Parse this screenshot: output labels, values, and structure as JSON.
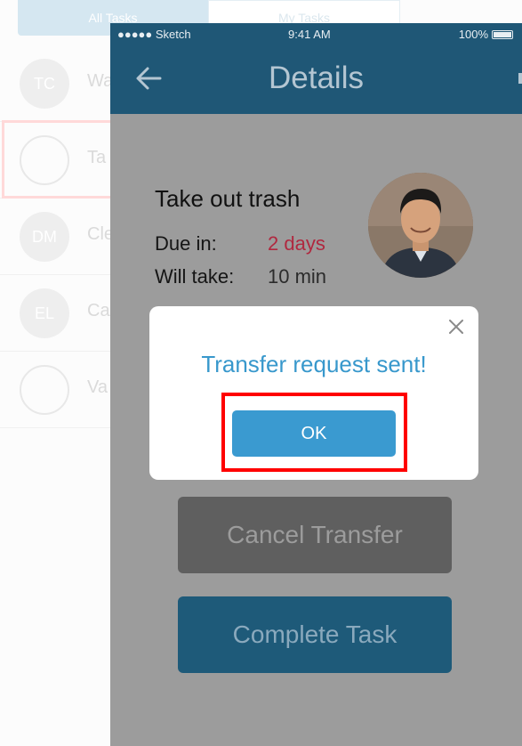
{
  "list_screen": {
    "tabs": [
      "All Tasks",
      "My Tasks"
    ],
    "rows": [
      {
        "initials": "TC",
        "text": "Wa"
      },
      {
        "initials": "",
        "text": "Ta"
      },
      {
        "initials": "DM",
        "text": "Cle"
      },
      {
        "initials": "EL",
        "text": "Ca"
      },
      {
        "initials": "",
        "text": "Va"
      }
    ]
  },
  "status_bar": {
    "carrier": "●●●●● Sketch",
    "time": "9:41 AM",
    "battery": "100%"
  },
  "nav": {
    "title": "Details",
    "back_icon": "back-arrow-icon"
  },
  "task": {
    "title": "Take out trash",
    "due_label": "Due in:",
    "due_value": "2 days",
    "take_label": "Will take:",
    "take_value": "10 min"
  },
  "buttons": {
    "cancel_transfer": "Cancel Transfer",
    "complete_task": "Complete Task"
  },
  "dialog": {
    "message": "Transfer request sent!",
    "ok": "OK",
    "close_icon": "close-icon"
  },
  "colors": {
    "nav": "#1f5776",
    "accent": "#3a9ad0",
    "due": "#b0283f",
    "highlight": "#ff0000"
  }
}
